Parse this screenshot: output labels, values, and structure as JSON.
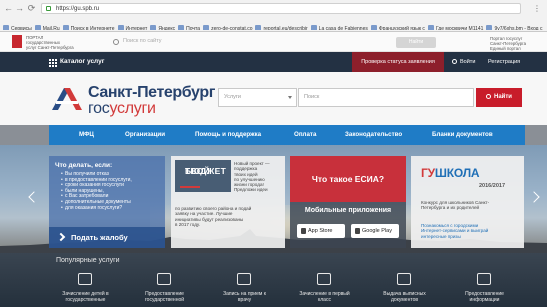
{
  "browser": {
    "url": "https://gu.spb.ru",
    "menu_glyph": "⋮",
    "back_glyph": "←",
    "forward_glyph": "→",
    "reload_glyph": "⟳",
    "bookmarks": [
      "Сервисы",
      "Mail.Ru",
      "Поиск в Интернете",
      "Интернет",
      "Яндекс",
      "Почта",
      "zero-de-constat.co",
      "reportal.eu/describir",
      "La casa de Fabiennes",
      "Французский язык с",
      "Где москвичи М1141",
      "9v7/6xhs.bm - Вход с"
    ]
  },
  "infobar": {
    "org_lines": [
      "ПОРТАЛ",
      "государственных",
      "услуг Санкт-Петербурга"
    ],
    "search_placeholder": "Поиск по сайту",
    "button_label": "Найти",
    "right_lines": [
      "Портал госуслуг",
      "Санкт-Петербурга",
      "Единый портал"
    ]
  },
  "catbar": {
    "catalog_label": "Каталог услуг",
    "check_status_label": "Проверка статуса заявления",
    "login_label": "Войти",
    "register_label": "Регистрация"
  },
  "header": {
    "logo_line1": "Санкт-Петербург",
    "logo_line2_a": "гос",
    "logo_line2_b": "услуги",
    "select_value": "Услуги",
    "search_placeholder": "Поиск",
    "search_button": "Найти"
  },
  "menu": {
    "items": [
      "МФЦ",
      "Организации",
      "Помощь и поддержка",
      "Оплата",
      "Законодательство",
      "Бланки документов"
    ]
  },
  "cards": {
    "complaint": {
      "title_lines": [
        "Что делать, если:"
      ],
      "bullets": [
        "Вы получили отказ",
        "в предоставлении госуслуги,",
        "сроки оказания госуслуги",
        "были нарушены,",
        "с Вас затребовали",
        "дополнительные документы",
        "для оказания госуслуги?"
      ],
      "cta": "Подать жалобу"
    },
    "budget": {
      "badge_line1": "ТВОЙ",
      "badge_line2": "БЮДЖЕТ",
      "side_lines": [
        "Новый проект —",
        "поддержка",
        "твоих идей",
        "по улучшению",
        "жизни города!",
        "Предложи идеи"
      ],
      "body_lines": [
        "по развитию своего района и подай",
        "заявку на участие. Лучшие",
        "инициативы будут реализованы",
        "в 2017 году."
      ]
    },
    "esia": {
      "title": "Что такое ЕСИА?",
      "apps_title": "Мобильные приложения",
      "app_store": "App Store",
      "google_play": "Google Play"
    },
    "school": {
      "logo_a": "ГУ",
      "logo_b": "ШКОЛА",
      "year": "2016/2017",
      "body_lines": [
        "Конкурс для школьников Санкт-",
        "Петербурга и их родителей"
      ],
      "body2_lines": [
        "Познакомься с городскими",
        "Интернет-сервисами и выиграй",
        "интересные призы"
      ]
    }
  },
  "popular": {
    "title": "Популярные услуги",
    "tiles": [
      {
        "label_lines": [
          "Зачисление детей в",
          "государственные"
        ]
      },
      {
        "label_lines": [
          "Предоставление",
          "государственной"
        ]
      },
      {
        "label_lines": [
          "Запись на прием к",
          "врачу"
        ]
      },
      {
        "label_lines": [
          "Зачисление в первый",
          "класс"
        ]
      },
      {
        "label_lines": [
          "Выдача выписных",
          "документов"
        ]
      },
      {
        "label_lines": [
          "Предоставление",
          "информации"
        ]
      }
    ]
  },
  "colors": {
    "brand_red": "#c81c2a",
    "navy": "#233143",
    "menu_blue": "#1f7cc6",
    "logo_blue": "#27426d"
  }
}
